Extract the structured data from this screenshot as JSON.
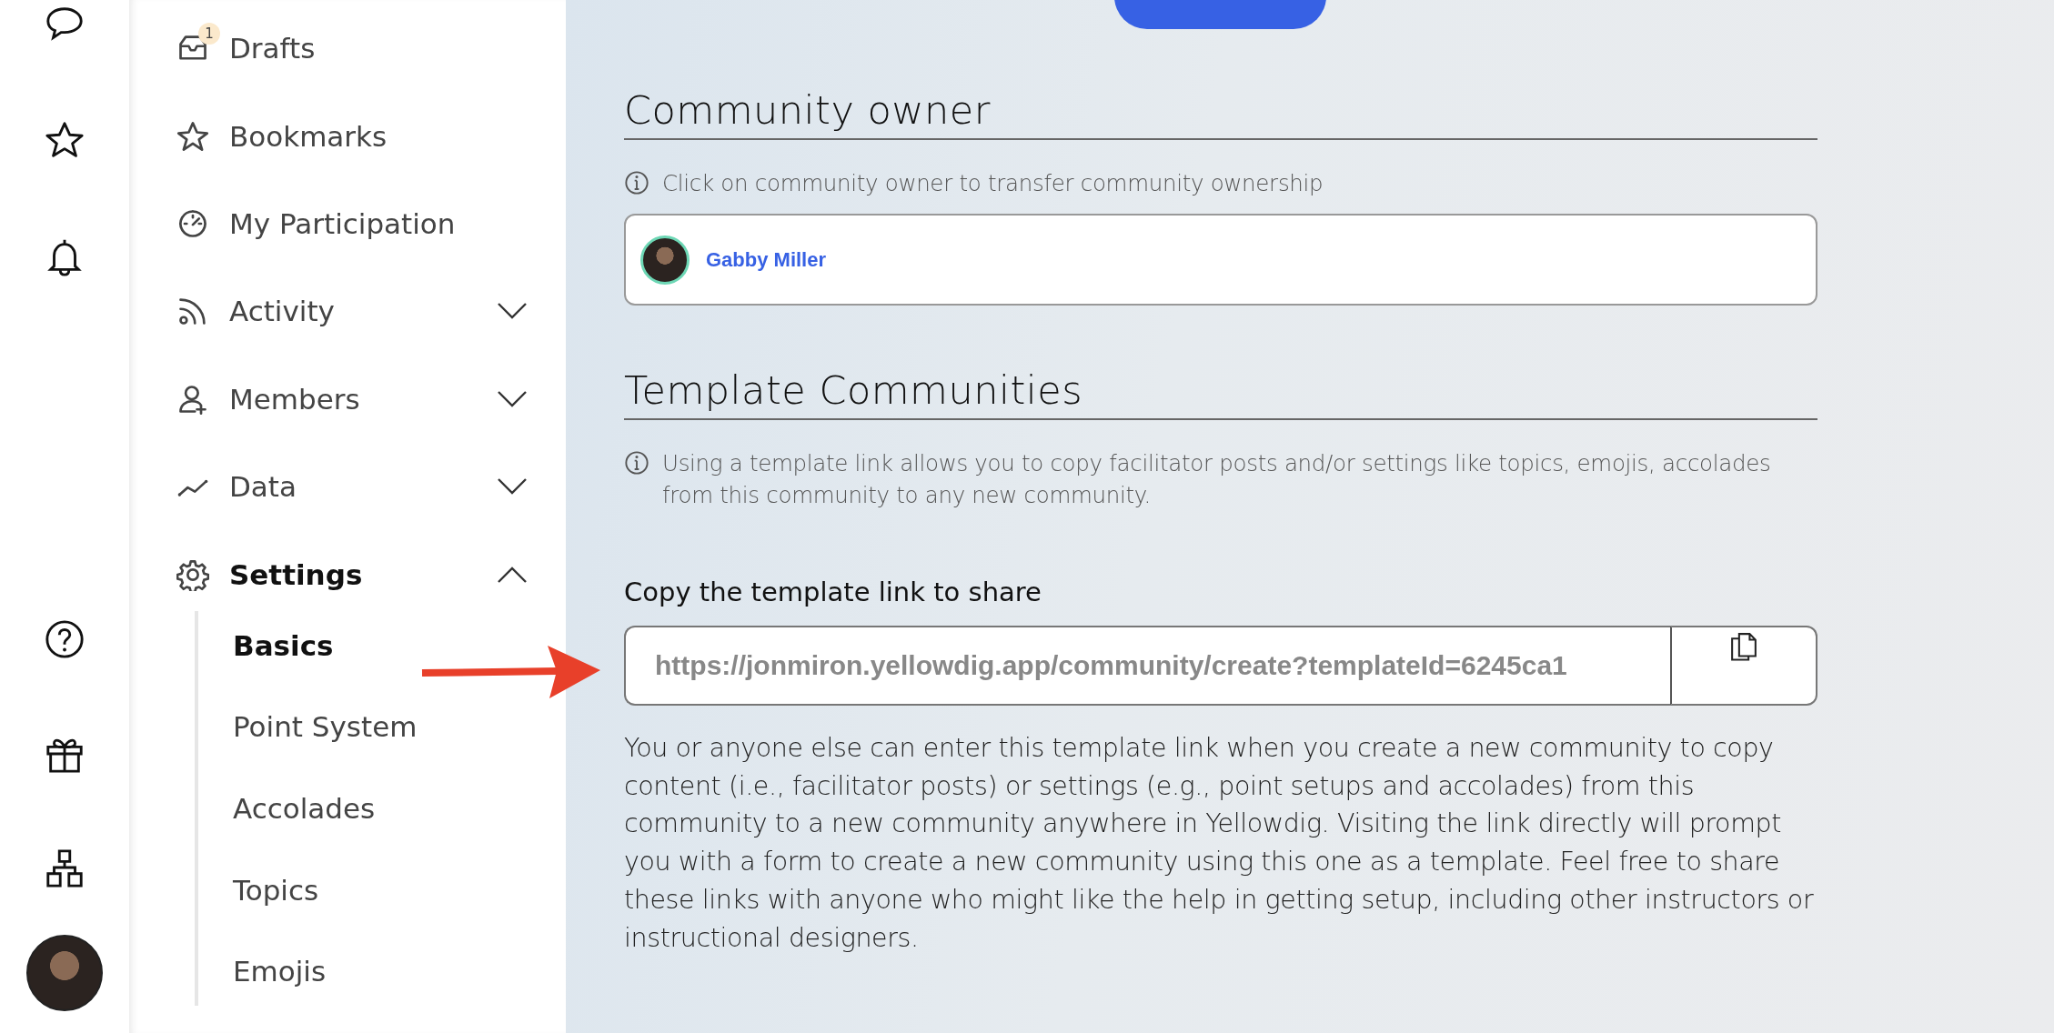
{
  "sidebar": {
    "items": [
      {
        "label": "Drafts",
        "badge": "1",
        "selected": false
      },
      {
        "label": "Bookmarks",
        "selected": false
      },
      {
        "label": "My Participation",
        "selected": false
      },
      {
        "label": "Activity",
        "selected": false,
        "expanded": false
      },
      {
        "label": "Members",
        "selected": false,
        "expanded": false
      },
      {
        "label": "Data",
        "selected": false,
        "expanded": false
      },
      {
        "label": "Settings",
        "selected": true,
        "expanded": true,
        "children": [
          {
            "label": "Basics",
            "selected": true
          },
          {
            "label": "Point System",
            "selected": false
          },
          {
            "label": "Accolades",
            "selected": false
          },
          {
            "label": "Topics",
            "selected": false
          },
          {
            "label": "Emojis",
            "selected": false
          }
        ]
      }
    ]
  },
  "community_owner": {
    "heading": "Community owner",
    "info": "Click on community owner to transfer community ownership",
    "owner": "Gabby Miller"
  },
  "template_communities": {
    "heading": "Template Communities",
    "info": "Using a template link allows you to copy facilitator posts and/or settings like topics, emojis, accolades from this community to any new community.",
    "link_label": "Copy the template link to share",
    "link_value": "https://jonmiron.yellowdig.app/community/create?templateId=6245ca1",
    "description": "You or anyone else can enter this template link when you create a new community to copy content (i.e., facilitator posts) or settings (e.g., point setups and accolades) from this community to a new community anywhere in Yellowdig. Visiting the link directly will prompt you with a form to create a new community using this one as a template. Feel free to share these links with anyone who might like the help in getting setup, including other instructors or instructional designers."
  }
}
